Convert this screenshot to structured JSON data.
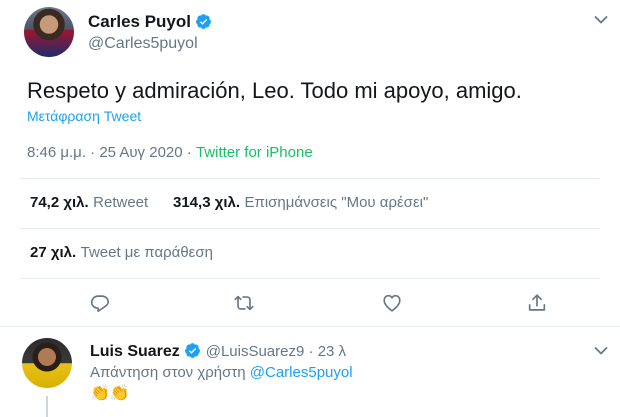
{
  "tweet": {
    "author_name": "Carles Puyol",
    "author_handle": "@Carles5puyol",
    "text": "Respeto y admiración, Leo. Todo mi apoyo, amigo.",
    "translate_label": "Μετάφραση Tweet",
    "time": "8:46 μ.μ.",
    "date_sep": " · ",
    "date": "25 Αυγ 2020",
    "source_sep": " · ",
    "source": "Twitter for iPhone",
    "retweets_count": "74,2 χιλ.",
    "retweets_label": "Retweet",
    "likes_count": "314,3 χιλ.",
    "likes_label": "Επισημάνσεις \"Μου αρέσει\"",
    "quotes_count": "27 χιλ.",
    "quotes_label": "Tweet με παράθεση"
  },
  "reply": {
    "author_name": "Luis Suarez",
    "author_handle": "@LuisSuarez9",
    "time_sep": " · ",
    "time": "23 λ",
    "replying_label": "Απάντηση στον χρήστη",
    "replying_to": "@Carles5puyol",
    "emoji": "👏👏"
  },
  "colors": {
    "link": "#1da1f2",
    "source": "#17bf63",
    "muted": "#657786",
    "verified": "#1da1f2"
  },
  "icons": [
    "verified-badge-icon",
    "chevron-down-icon",
    "reply-icon",
    "retweet-icon",
    "like-icon",
    "share-icon"
  ]
}
